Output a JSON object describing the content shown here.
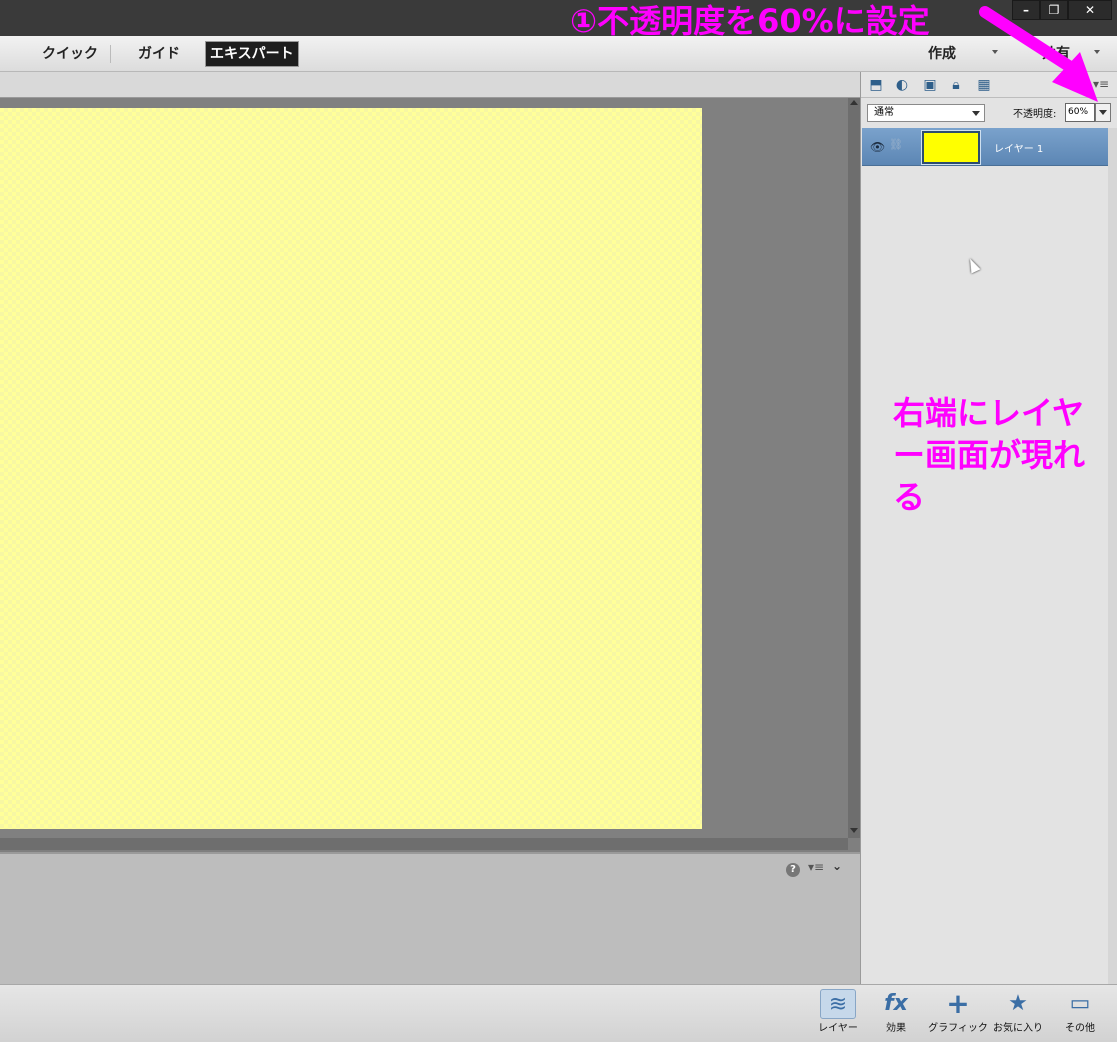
{
  "window": {
    "minimize_label": "–",
    "restore_label": "❐",
    "close_label": "✕"
  },
  "modes": {
    "quick": "クイック",
    "guide": "ガイド",
    "expert": "エキスパート",
    "create": "作成",
    "share": "共有"
  },
  "layers_panel": {
    "blend_mode": "通常",
    "opacity_label": "不透明度:",
    "opacity_value": "60%",
    "layer_name": "レイヤー 1",
    "layer_color": "#ffff00",
    "icons": [
      "new-layer-icon",
      "adjustment-layer-icon",
      "mask-icon",
      "lock-icon",
      "lock-transparency-icon"
    ]
  },
  "options_panel": {
    "help_label": "?"
  },
  "bottombar": {
    "layers": "レイヤー",
    "effects": "効果",
    "graphics": "グラフィック",
    "favorites": "お気に入り",
    "more": "その他"
  },
  "annotations": {
    "opacity_note": "①不透明度を60%に設定",
    "layer_note": "右端にレイヤー画面が現れる",
    "color": "#ff00ff"
  }
}
